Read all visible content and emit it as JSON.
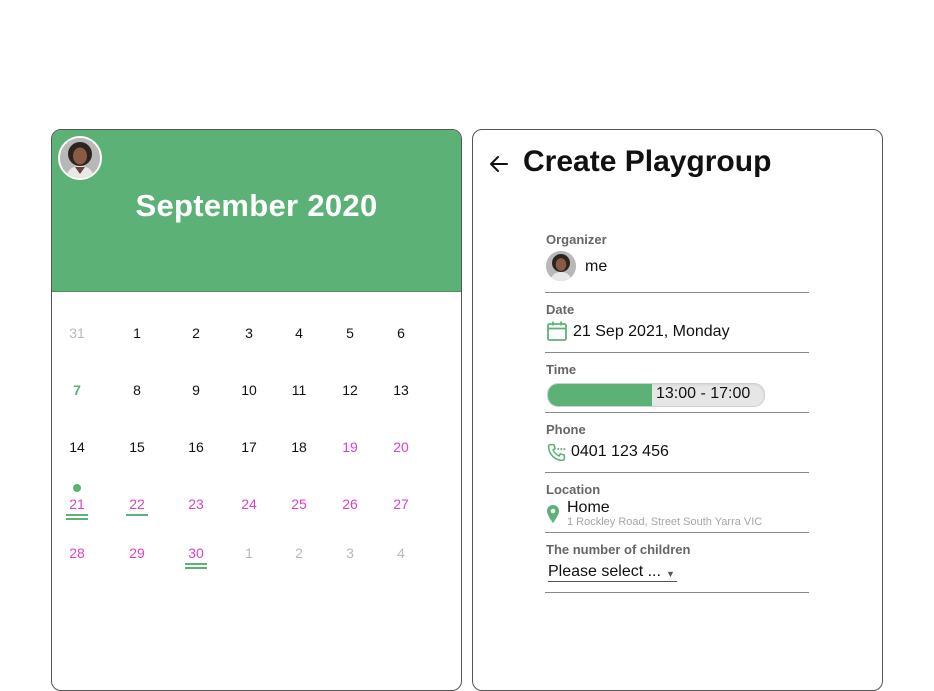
{
  "calendar": {
    "month_label": "September 2020",
    "weeks": [
      [
        {
          "d": "31",
          "s": "muted"
        },
        {
          "d": "1",
          "s": ""
        },
        {
          "d": "2",
          "s": ""
        },
        {
          "d": "3",
          "s": ""
        },
        {
          "d": "4",
          "s": ""
        },
        {
          "d": "5",
          "s": ""
        },
        {
          "d": "6",
          "s": ""
        }
      ],
      [
        {
          "d": "7",
          "s": "today"
        },
        {
          "d": "8",
          "s": ""
        },
        {
          "d": "9",
          "s": ""
        },
        {
          "d": "10",
          "s": ""
        },
        {
          "d": "11",
          "s": ""
        },
        {
          "d": "12",
          "s": ""
        },
        {
          "d": "13",
          "s": ""
        }
      ],
      [
        {
          "d": "14",
          "s": ""
        },
        {
          "d": "15",
          "s": ""
        },
        {
          "d": "16",
          "s": ""
        },
        {
          "d": "17",
          "s": ""
        },
        {
          "d": "18",
          "s": ""
        },
        {
          "d": "19",
          "s": "pink"
        },
        {
          "d": "20",
          "s": "pink"
        }
      ],
      [
        {
          "d": "21",
          "s": "pink",
          "dot": true,
          "lines": 2
        },
        {
          "d": "22",
          "s": "pink",
          "lines": 1
        },
        {
          "d": "23",
          "s": "pink"
        },
        {
          "d": "24",
          "s": "pink"
        },
        {
          "d": "25",
          "s": "pink"
        },
        {
          "d": "26",
          "s": "pink"
        },
        {
          "d": "27",
          "s": "pink"
        }
      ],
      [
        {
          "d": "28",
          "s": "pink"
        },
        {
          "d": "29",
          "s": "pink"
        },
        {
          "d": "30",
          "s": "pink",
          "lines": 2
        },
        {
          "d": "1",
          "s": "muted"
        },
        {
          "d": "2",
          "s": "muted"
        },
        {
          "d": "3",
          "s": "muted"
        },
        {
          "d": "4",
          "s": "muted"
        }
      ]
    ]
  },
  "form": {
    "title": "Create Playgroup",
    "organizer": {
      "label": "Organizer",
      "value": "me"
    },
    "date": {
      "label": "Date",
      "value": "21 Sep 2021, Monday"
    },
    "time": {
      "label": "Time",
      "value": "13:00 - 17:00",
      "fill_fraction": 0.48
    },
    "phone": {
      "label": "Phone",
      "value": "0401 123 456"
    },
    "location": {
      "label": "Location",
      "value": "Home",
      "address": "1 Rockley Road, Street South Yarra VIC"
    },
    "children": {
      "label": "The number of children",
      "value": "Please select ..."
    }
  },
  "icons": {
    "back": "arrow-left-icon",
    "date": "calendar-icon",
    "phone": "phone-icon",
    "location": "map-pin-icon",
    "select": "caret-down-icon"
  },
  "colors": {
    "accent": "#5cb276",
    "weekend_pink": "#e03fc8",
    "muted": "#b9b9b9"
  }
}
